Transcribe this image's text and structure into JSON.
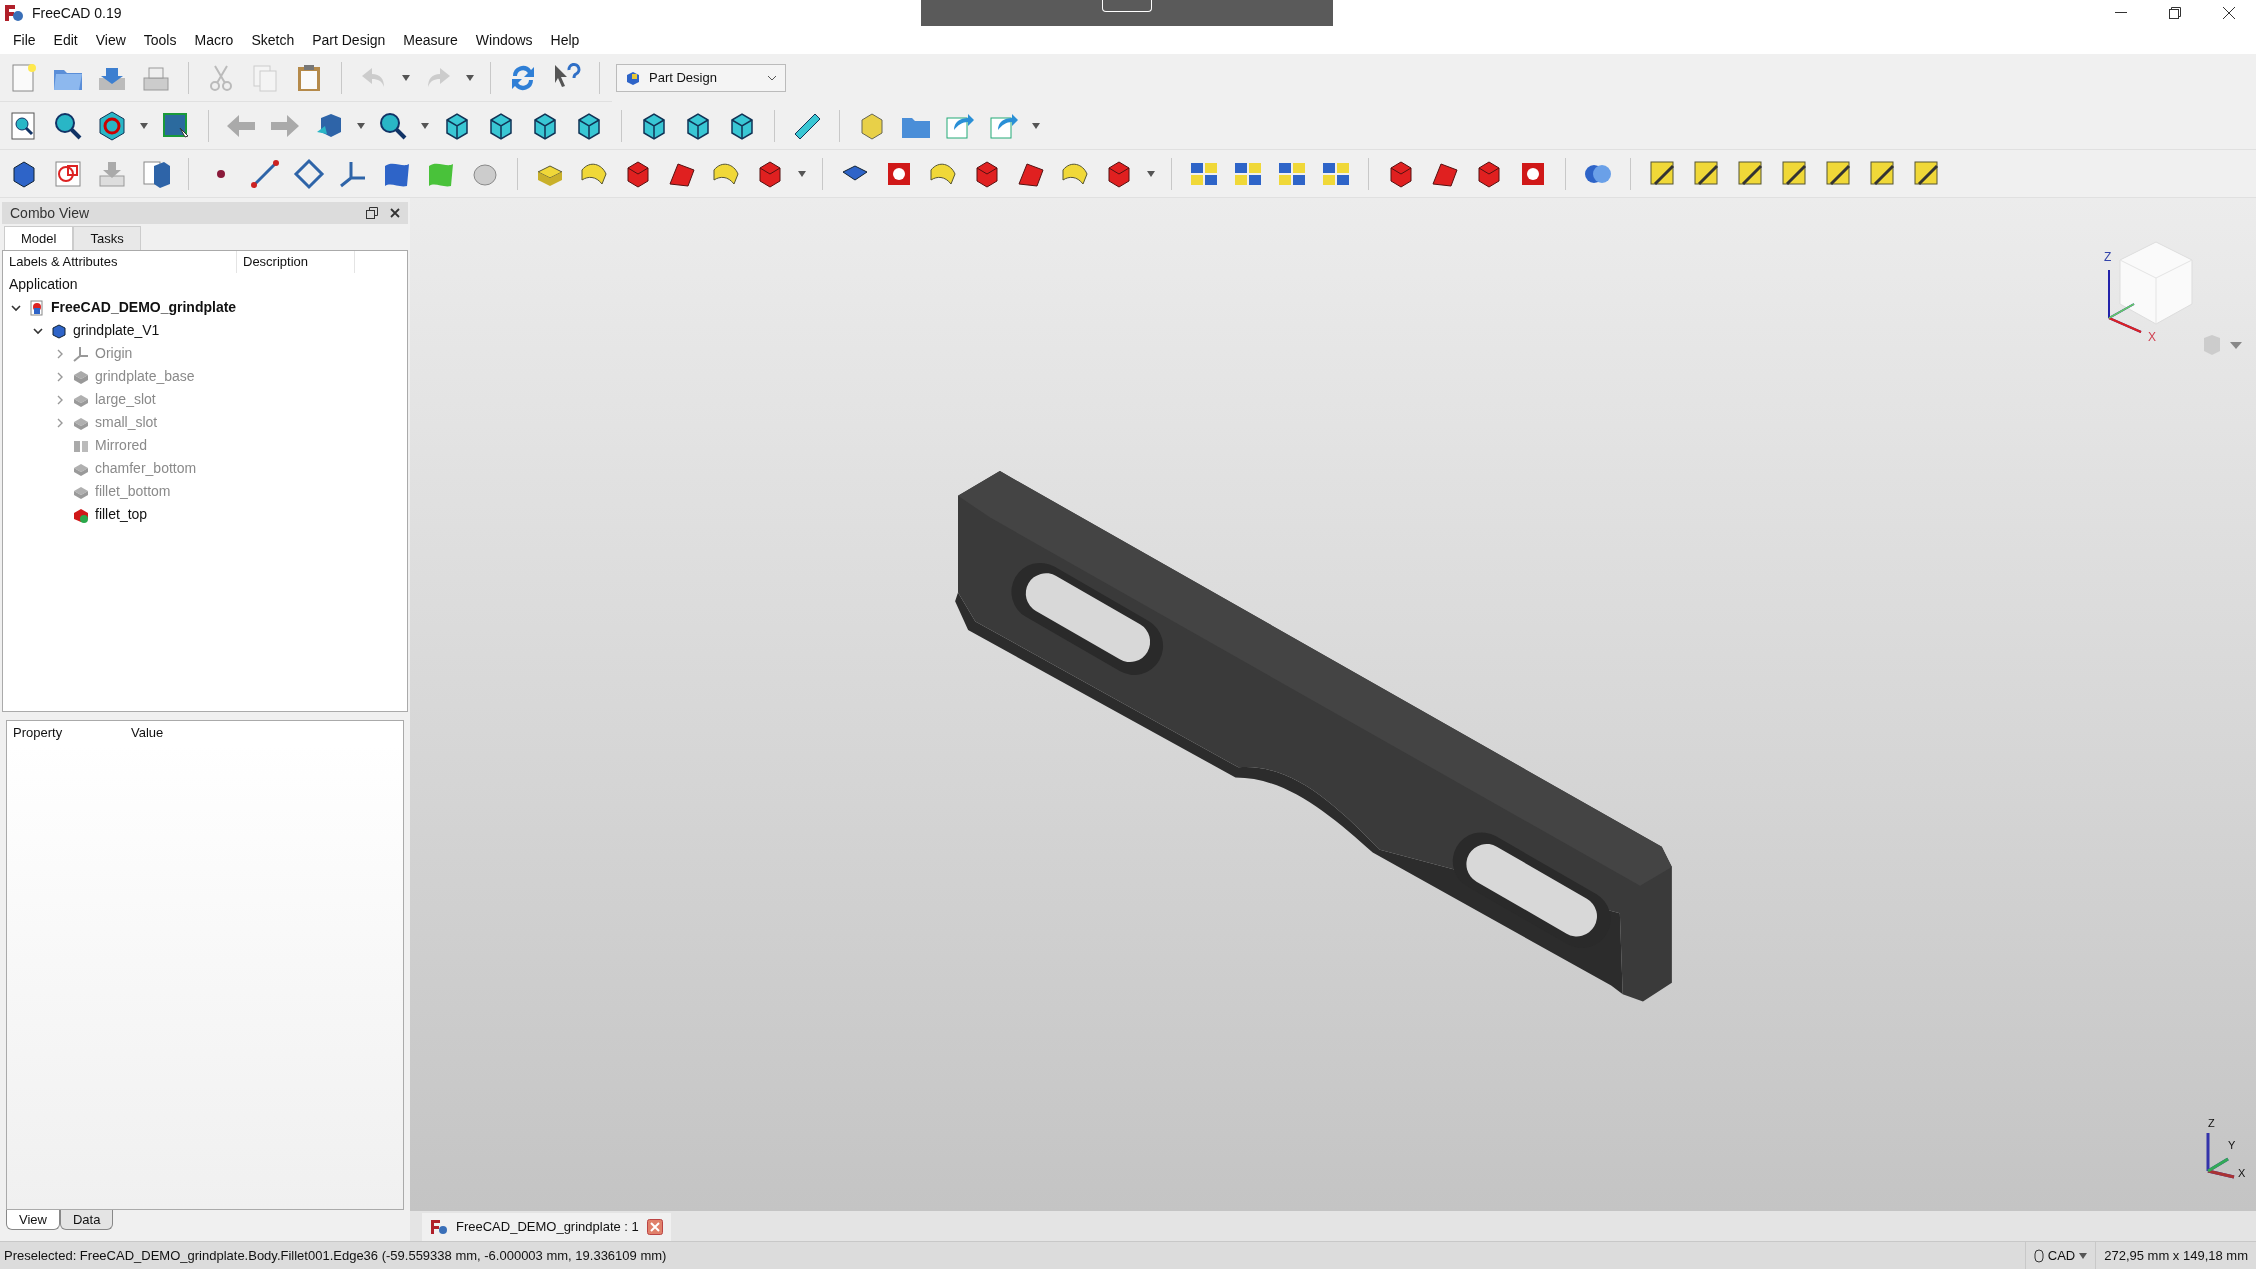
{
  "window": {
    "title": "FreeCAD 0.19"
  },
  "menu": [
    "File",
    "Edit",
    "View",
    "Tools",
    "Macro",
    "Sketch",
    "Part Design",
    "Measure",
    "Windows",
    "Help"
  ],
  "workbench": {
    "value": "Part Design"
  },
  "combo_view": {
    "title": "Combo View",
    "tabs": [
      {
        "label": "Model",
        "selected": true
      },
      {
        "label": "Tasks",
        "selected": false
      }
    ],
    "tree": {
      "columns": [
        "Labels & Attributes",
        "Description"
      ],
      "group": "Application",
      "items": [
        {
          "label": "FreeCAD_DEMO_grindplate",
          "kind": "document",
          "expanded": true,
          "hidden": false,
          "bold": true,
          "children": [
            {
              "label": "grindplate_V1",
              "kind": "body",
              "expanded": true,
              "hidden": false,
              "bold": false,
              "children": [
                {
                  "label": "Origin",
                  "kind": "origin",
                  "expanded": false,
                  "hidden": true,
                  "bold": false
                },
                {
                  "label": "grindplate_base",
                  "kind": "pad",
                  "expanded": false,
                  "hidden": true,
                  "bold": false
                },
                {
                  "label": "large_slot",
                  "kind": "feature",
                  "expanded": false,
                  "hidden": true,
                  "bold": false
                },
                {
                  "label": "small_slot",
                  "kind": "feature",
                  "expanded": false,
                  "hidden": true,
                  "bold": false
                },
                {
                  "label": "Mirrored",
                  "kind": "mirrored",
                  "hidden": true,
                  "bold": false
                },
                {
                  "label": "chamfer_bottom",
                  "kind": "feature",
                  "hidden": true,
                  "bold": false
                },
                {
                  "label": "fillet_bottom",
                  "kind": "feature",
                  "hidden": true,
                  "bold": false
                },
                {
                  "label": "fillet_top",
                  "kind": "tip",
                  "hidden": false,
                  "bold": false
                }
              ]
            }
          ]
        }
      ]
    },
    "properties": {
      "columns": [
        "Property",
        "Value"
      ]
    },
    "bottom_tabs": [
      {
        "label": "View",
        "selected": true
      },
      {
        "label": "Data",
        "selected": false
      }
    ]
  },
  "viewport": {
    "nav_cube": {
      "axis_z": "Z",
      "axis_x": "X"
    },
    "axis_cross": {
      "z": "Z",
      "y": "Y",
      "x": "X"
    }
  },
  "document_tabs": [
    {
      "label": "FreeCAD_DEMO_grindplate : 1",
      "selected": true
    }
  ],
  "status_bar": {
    "message": "Preselected: FreeCAD_DEMO_grindplate.Body.Fillet001.Edge36 (-59.559338 mm, -6.000003 mm, 19.336109 mm)",
    "navigation": "CAD",
    "dimensions": "272,95 mm x 149,18 mm"
  }
}
